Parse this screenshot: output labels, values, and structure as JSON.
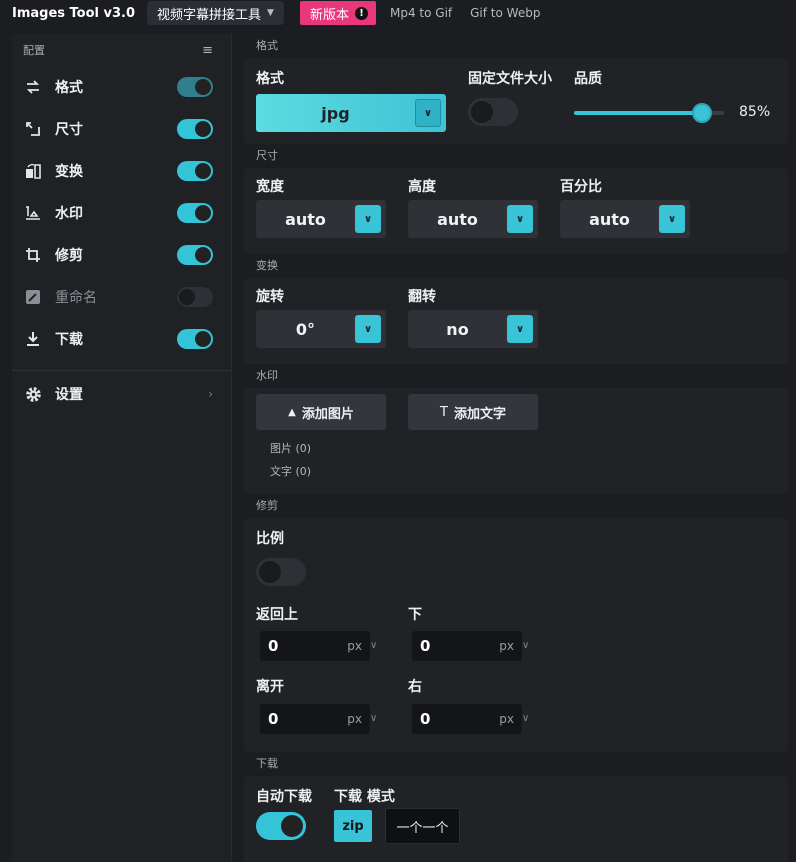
{
  "topbar": {
    "app_title": "Images Tool v3.0",
    "tool_select": "视频字幕拼接工具",
    "new_version": "新版本",
    "new_version_badge": "!",
    "links": [
      "Mp4 to Gif",
      "Gif to Webp"
    ]
  },
  "sidebar": {
    "header": "配置",
    "items": [
      {
        "label": "格式",
        "icon": "swap-arrows-icon",
        "enabled": true
      },
      {
        "label": "尺寸",
        "icon": "resize-icon",
        "enabled": true
      },
      {
        "label": "变换",
        "icon": "transform-icon",
        "enabled": true
      },
      {
        "label": "水印",
        "icon": "watermark-icon",
        "enabled": true
      },
      {
        "label": "修剪",
        "icon": "crop-icon",
        "enabled": true
      },
      {
        "label": "重命名",
        "icon": "rename-icon",
        "enabled": false
      },
      {
        "label": "下载",
        "icon": "download-icon",
        "enabled": true
      }
    ],
    "settings": "设置"
  },
  "format": {
    "section": "格式",
    "format_label": "格式",
    "format_value": "jpg",
    "fixed_size_label": "固定文件大小",
    "fixed_size_enabled": false,
    "quality_label": "品质",
    "quality_value": "85%",
    "quality_fraction": 0.85
  },
  "size": {
    "section": "尺寸",
    "width_label": "宽度",
    "width_value": "auto",
    "height_label": "高度",
    "height_value": "auto",
    "percent_label": "百分比",
    "percent_value": "auto"
  },
  "transform": {
    "section": "变换",
    "rotate_label": "旋转",
    "rotate_value": "0°",
    "flip_label": "翻转",
    "flip_value": "no"
  },
  "watermark": {
    "section": "水印",
    "add_image": "添加图片",
    "add_text": "添加文字",
    "images_count": "图片 (0)",
    "texts_count": "文字 (0)"
  },
  "crop": {
    "section": "修剪",
    "ratio_label": "比例",
    "ratio_enabled": false,
    "top_label": "返回上",
    "top_value": "0",
    "bottom_label": "下",
    "bottom_value": "0",
    "left_label": "离开",
    "left_value": "0",
    "right_label": "右",
    "right_value": "0",
    "unit": "px"
  },
  "download": {
    "section": "下载",
    "auto_label": "自动下载",
    "auto_enabled": true,
    "mode_label": "下载 模式",
    "mode_zip": "zip",
    "mode_single": "一个一个"
  },
  "colors": {
    "accent": "#39c3d6",
    "new_badge": "#e8377a",
    "background": "#1b1d21"
  }
}
